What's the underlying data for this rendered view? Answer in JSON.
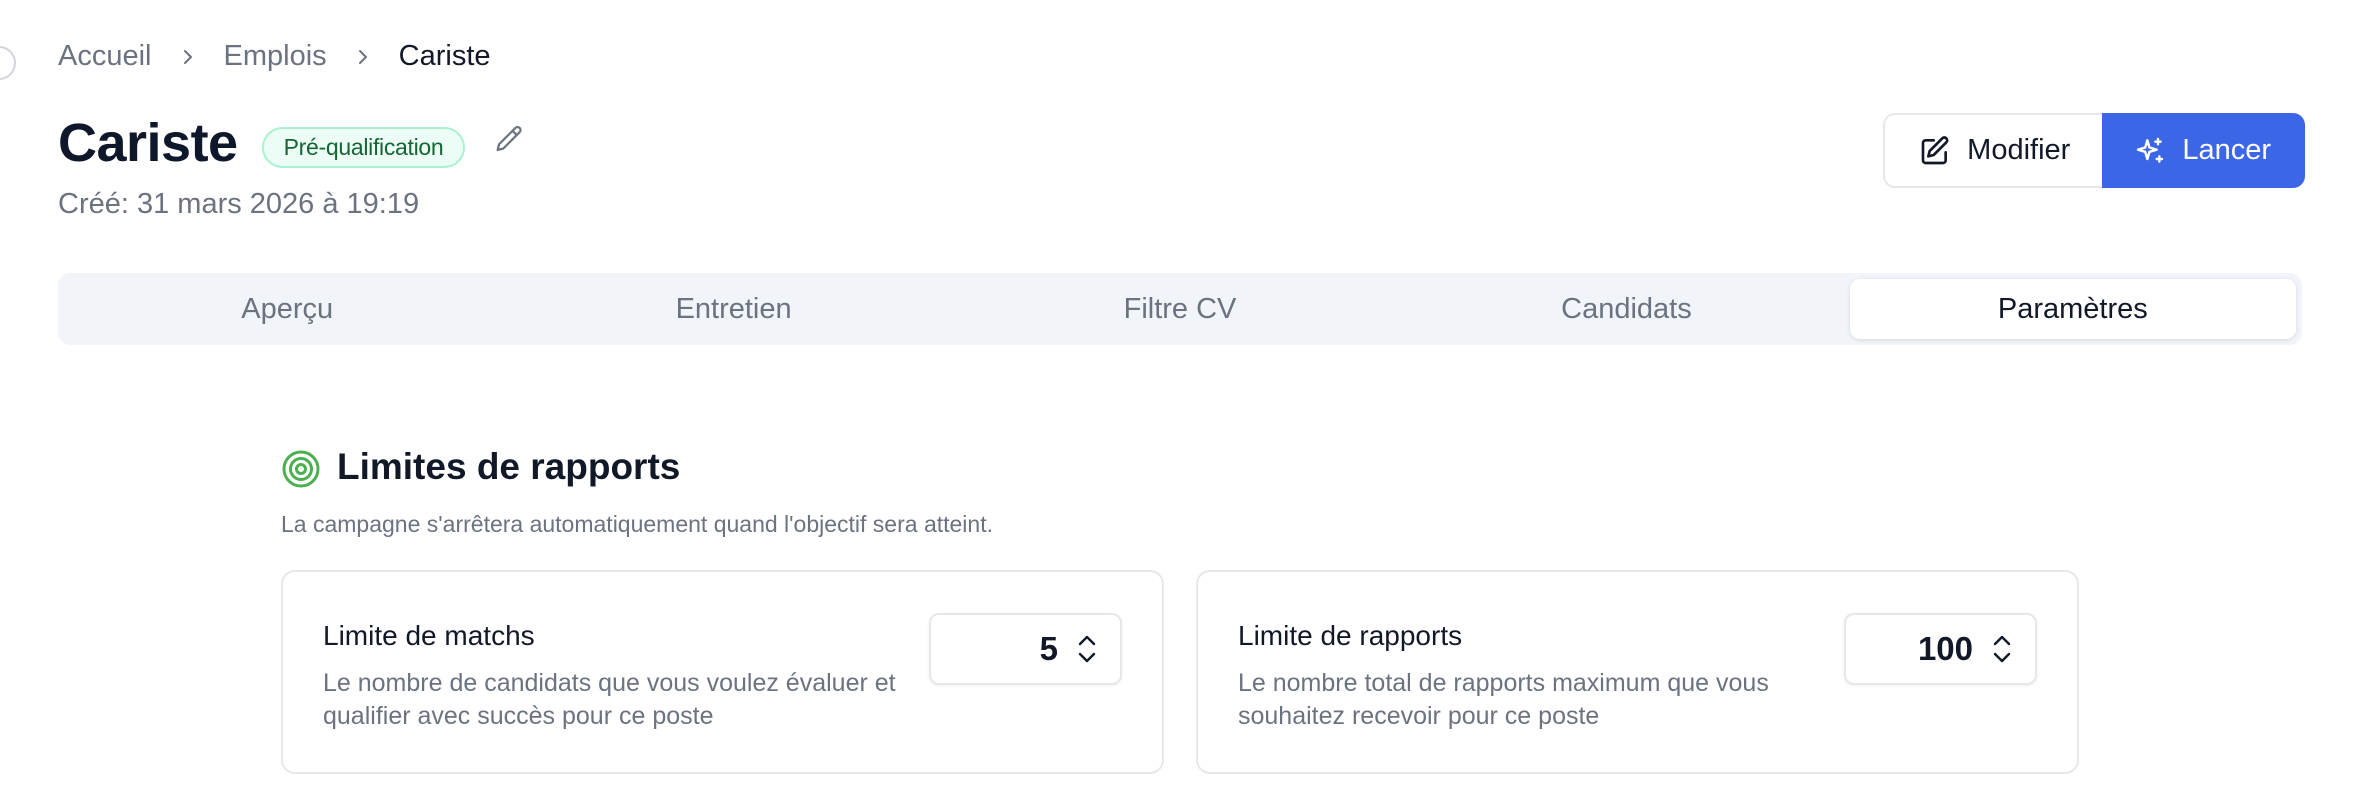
{
  "breadcrumb": {
    "items": [
      "Accueil",
      "Emplois"
    ],
    "current": "Cariste"
  },
  "job": {
    "title": "Cariste",
    "status": "Pré-qualification",
    "created": "Créé: 31 mars 2026 à 19:19"
  },
  "actions": {
    "edit_label": "Modifier",
    "launch_label": "Lancer"
  },
  "tabs": [
    {
      "label": "Aperçu",
      "active": false
    },
    {
      "label": "Entretien",
      "active": false
    },
    {
      "label": "Filtre CV",
      "active": false
    },
    {
      "label": "Candidats",
      "active": false
    },
    {
      "label": "Paramètres",
      "active": true
    }
  ],
  "limits": {
    "title": "Limites de rapports",
    "description": "La campagne s'arrêtera automatiquement quand l'objectif sera atteint.",
    "match_limit": {
      "title": "Limite de matchs",
      "description": "Le nombre de candidats que vous voulez évaluer et qualifier avec succès pour ce poste",
      "value": "5"
    },
    "report_limit": {
      "title": "Limite de rapports",
      "description": "Le nombre total de rapports maximum que vous souhaitez recevoir pour ce poste",
      "value": "100"
    }
  },
  "colors": {
    "primary": "#3b66e6",
    "badge_bg": "#ecfdf5",
    "badge_border": "#a7f3d0",
    "badge_text": "#166534",
    "target_icon": "#4caf50",
    "muted_text": "#6b7280"
  },
  "icons": {
    "breadcrumb_separator": "chevron-right-icon",
    "title_edit": "pencil-icon",
    "edit_button": "edit-square-icon",
    "launch_button": "sparkles-icon",
    "section": "target-icon",
    "stepper": "chevron-up-down-icon"
  }
}
